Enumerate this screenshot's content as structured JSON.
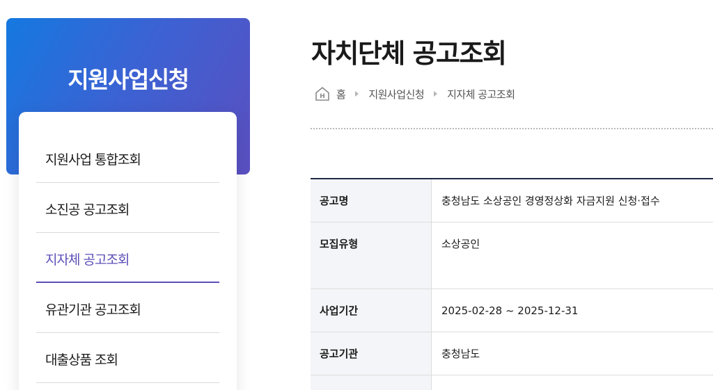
{
  "sidebar": {
    "title": "지원사업신청",
    "items": [
      {
        "label": "지원사업 통합조회",
        "active": false
      },
      {
        "label": "소진공 공고조회",
        "active": false
      },
      {
        "label": "지자체 공고조회",
        "active": true
      },
      {
        "label": "유관기관 공고조회",
        "active": false
      },
      {
        "label": "대출상품 조회",
        "active": false
      }
    ]
  },
  "header": {
    "title": "자치단체 공고조회",
    "breadcrumb": [
      "홈",
      "지원사업신청",
      "지자체 공고조회"
    ]
  },
  "detail": {
    "rows": [
      {
        "label": "공고명",
        "value": "충청남도 소상공인 경영정상화 자금지원 신청·접수"
      },
      {
        "label": "모집유형",
        "value": "소상공인"
      },
      {
        "label": "사업기간",
        "value": "2025-02-28 ~ 2025-12-31"
      },
      {
        "label": "공고기관",
        "value": "충청남도"
      },
      {
        "label": "",
        "value": ""
      }
    ]
  },
  "colors": {
    "accent": "#5a4fb8",
    "sidebar_gradient_start": "#1579e0",
    "sidebar_gradient_end": "#5b4fc0",
    "table_top_border": "#1e2a45"
  },
  "icons": {
    "home": "home-icon",
    "breadcrumb_separator": "chevron-right-icon"
  }
}
